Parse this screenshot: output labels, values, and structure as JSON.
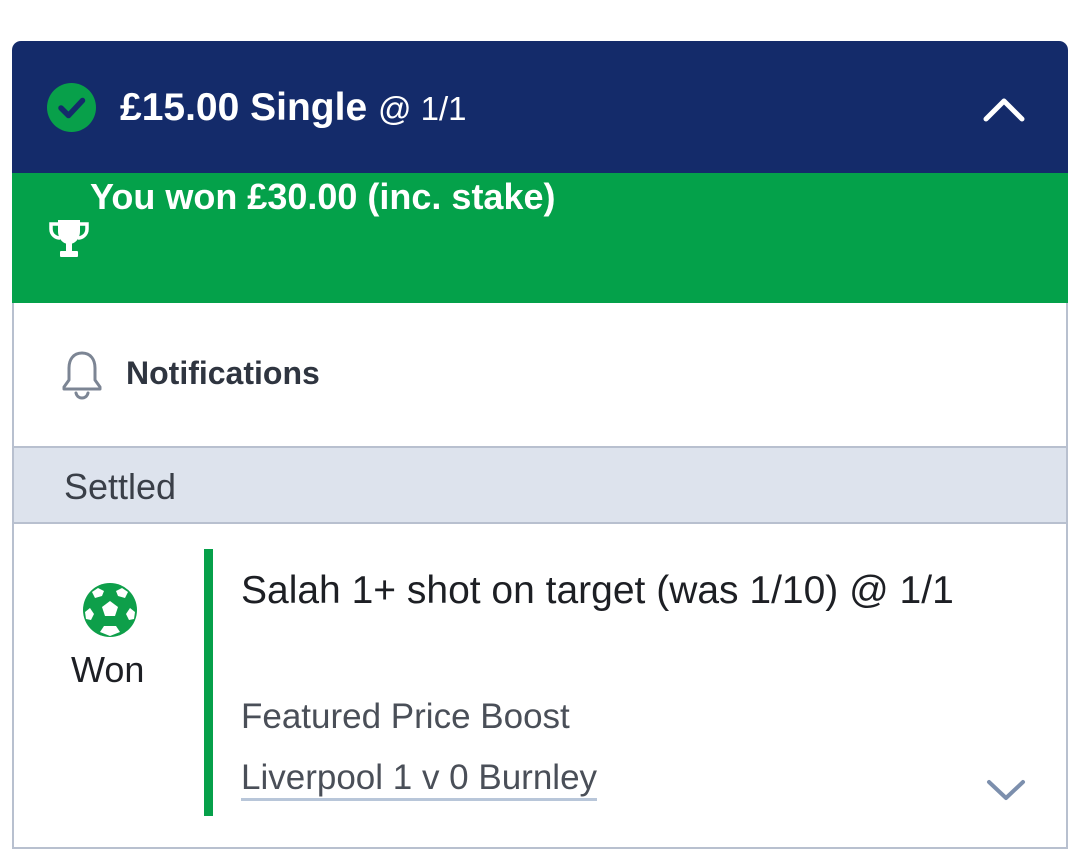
{
  "bet": {
    "title": "£15.00 Single",
    "odds": "@ 1/1",
    "status_icon": "check-circle-icon",
    "collapse_icon": "chevron-up-icon"
  },
  "win_banner": {
    "icon": "trophy-icon",
    "text": "You won £30.00 (inc. stake)"
  },
  "notifications": {
    "icon": "bell-icon",
    "label": "Notifications"
  },
  "section": {
    "label": "Settled"
  },
  "selection": {
    "icon": "football-icon",
    "result": "Won",
    "title": "Salah 1+ shot on target (was 1/10) @ 1/1",
    "market": "Featured Price Boost",
    "event": "Liverpool 1 v 0 Burnley",
    "expand_icon": "chevron-down-icon"
  },
  "colors": {
    "header_bg": "#142b6a",
    "win_green": "#04a14a",
    "settled_bg": "#dde3ed",
    "border": "#b8c0cf"
  }
}
